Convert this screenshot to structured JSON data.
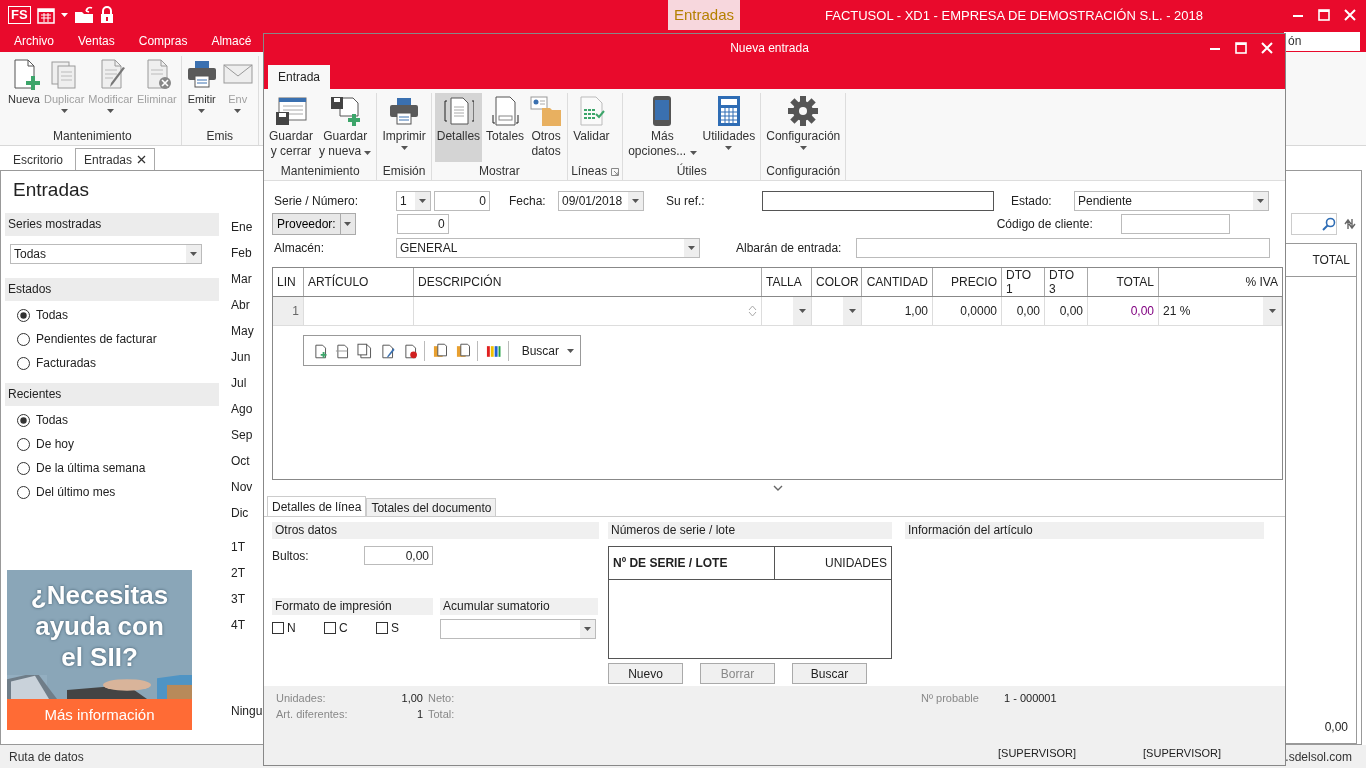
{
  "app": {
    "logo": "FS",
    "context_tab": "Entradas",
    "title": "FACTUSOL - XD1 - EMPRESA DE DEMOSTRACIÓN S.L. - 2018"
  },
  "menu": [
    "Archivo",
    "Ventas",
    "Compras",
    "Almacé"
  ],
  "search_value": "ón",
  "ribbon": {
    "groups": [
      {
        "label": "Mantenimiento",
        "buttons": [
          {
            "label": "Nueva",
            "disabled": false,
            "dropdown": false
          },
          {
            "label": "Duplicar",
            "disabled": true,
            "dropdown": true
          },
          {
            "label": "Modificar",
            "disabled": true,
            "dropdown": true
          },
          {
            "label": "Eliminar",
            "disabled": true,
            "dropdown": false
          }
        ]
      },
      {
        "label": "Emis",
        "buttons": [
          {
            "label": "Emitir",
            "disabled": false,
            "dropdown": true
          },
          {
            "label": "Env",
            "disabled": true,
            "dropdown": true
          }
        ]
      }
    ]
  },
  "doc_tabs": [
    {
      "label": "Escritorio",
      "selected": false,
      "closable": false
    },
    {
      "label": "Entradas",
      "selected": true,
      "closable": true
    }
  ],
  "page_title": "Entradas",
  "sidebar": [
    {
      "title": "Series mostradas",
      "kind": "dropdown",
      "value": "Todas"
    },
    {
      "title": "Estados",
      "kind": "radios",
      "options": [
        {
          "label": "Todas",
          "selected": true
        },
        {
          "label": "Pendientes de facturar",
          "selected": false
        },
        {
          "label": "Facturadas",
          "selected": false
        }
      ]
    },
    {
      "title": "Recientes",
      "kind": "radios",
      "options": [
        {
          "label": "Todas",
          "selected": true
        },
        {
          "label": "De hoy",
          "selected": false
        },
        {
          "label": "De la última semana",
          "selected": false
        },
        {
          "label": "Del último mes",
          "selected": false
        }
      ]
    }
  ],
  "ad": {
    "kind": "picture",
    "headline": "¿Necesitas ayuda con el SII?",
    "button": "Más información"
  },
  "periods": [
    "Ene",
    "Feb",
    "Mar",
    "Abr",
    "May",
    "Jun",
    "Jul",
    "Ago",
    "Sep",
    "Oct",
    "Nov",
    "Dic"
  ],
  "quarters": [
    "1T",
    "2T",
    "3T",
    "4T"
  ],
  "period_other": "Ningu",
  "list": {
    "columns": [
      "TOTAL"
    ],
    "footer_total": "0,00"
  },
  "status_bar": {
    "left": "Ruta de datos",
    "right": ".sdelsol.com"
  },
  "dialog": {
    "title": "Nueva entrada",
    "tabs": [
      {
        "label": "Entrada",
        "selected": true
      }
    ],
    "ribbon": [
      {
        "label": "Mantenimiento",
        "launcher": false,
        "buttons": [
          {
            "label": "Guardar y cerrar",
            "selected": false,
            "dropdown": false
          },
          {
            "label": "Guardar y nueva",
            "selected": false,
            "dropdown": true
          }
        ]
      },
      {
        "label": "Emisión",
        "launcher": false,
        "buttons": [
          {
            "label": "Imprimir",
            "selected": false,
            "dropdown": true
          }
        ]
      },
      {
        "label": "Mostrar",
        "launcher": false,
        "buttons": [
          {
            "label": "Detalles",
            "selected": true,
            "dropdown": false
          },
          {
            "label": "Totales",
            "selected": false,
            "dropdown": false
          },
          {
            "label": "Otros datos",
            "selected": false,
            "dropdown": false
          }
        ]
      },
      {
        "label": "Líneas",
        "launcher": true,
        "buttons": [
          {
            "label": "Validar",
            "selected": false,
            "dropdown": false
          }
        ]
      },
      {
        "label": "Útiles",
        "launcher": false,
        "buttons": [
          {
            "label": "Más opciones...",
            "selected": false,
            "dropdown": true
          },
          {
            "label": "Utilidades",
            "selected": false,
            "dropdown": true
          }
        ]
      },
      {
        "label": "Configuración",
        "launcher": false,
        "buttons": [
          {
            "label": "Configuración",
            "selected": false,
            "dropdown": true
          }
        ]
      }
    ],
    "form": {
      "serie_label": "Serie / Número:",
      "serie": "1",
      "numero": "0",
      "fecha_label": "Fecha:",
      "fecha": "09/01/2018",
      "suref_label": "Su ref.:",
      "estado_label": "Estado:",
      "estado": "Pendiente",
      "proveedor_button": "Proveedor:",
      "proveedor": "0",
      "codigo_label": "Código de cliente:",
      "almacen_label": "Almacén:",
      "almacen": "GENERAL",
      "albaran_label": "Albarán de entrada:"
    },
    "grid": {
      "columns": [
        "LIN",
        "ARTÍCULO",
        "DESCRIPCIÓN",
        "TALLA",
        "COLOR",
        "CANTIDAD",
        "PRECIO",
        "DTO 1",
        "DTO 3",
        "TOTAL",
        "% IVA"
      ],
      "rows": [
        {
          "lin": "1",
          "cantidad": "1,00",
          "precio": "0,0000",
          "dto1": "0,00",
          "dto3": "0,00",
          "total": "0,00",
          "iva": "21 %"
        }
      ]
    },
    "line_toolbar": {
      "search": "Buscar"
    },
    "bottom_tabs": [
      {
        "label": "Detalles de línea",
        "selected": true
      },
      {
        "label": "Totales del documento",
        "selected": false
      }
    ],
    "otros": {
      "title": "Otros datos",
      "bultos_label": "Bultos:",
      "bultos": "0,00"
    },
    "formato": {
      "title": "Formato de impresión",
      "options": [
        {
          "label": "N",
          "checked": false
        },
        {
          "label": "C",
          "checked": false
        },
        {
          "label": "S",
          "checked": false
        }
      ]
    },
    "acumular": {
      "title": "Acumular sumatorio"
    },
    "serie_lote": {
      "title": "Números de serie / lote",
      "columns": [
        "Nº DE SERIE / LOTE",
        "UNIDADES"
      ],
      "buttons": [
        {
          "label": "Nuevo",
          "disabled": false
        },
        {
          "label": "Borrar",
          "disabled": true
        },
        {
          "label": "Buscar",
          "disabled": false
        }
      ]
    },
    "info_title": "Información del artículo",
    "summary": {
      "unidades_label": "Unidades:",
      "unidades": "1,00",
      "neto_label": "Neto:",
      "art_label": "Art. diferentes:",
      "art": "1",
      "total_label": "Total:",
      "probable_label": "Nº probable",
      "probable": "1 - 000001"
    },
    "users": [
      "[SUPERVISOR]",
      "[SUPERVISOR]"
    ]
  }
}
